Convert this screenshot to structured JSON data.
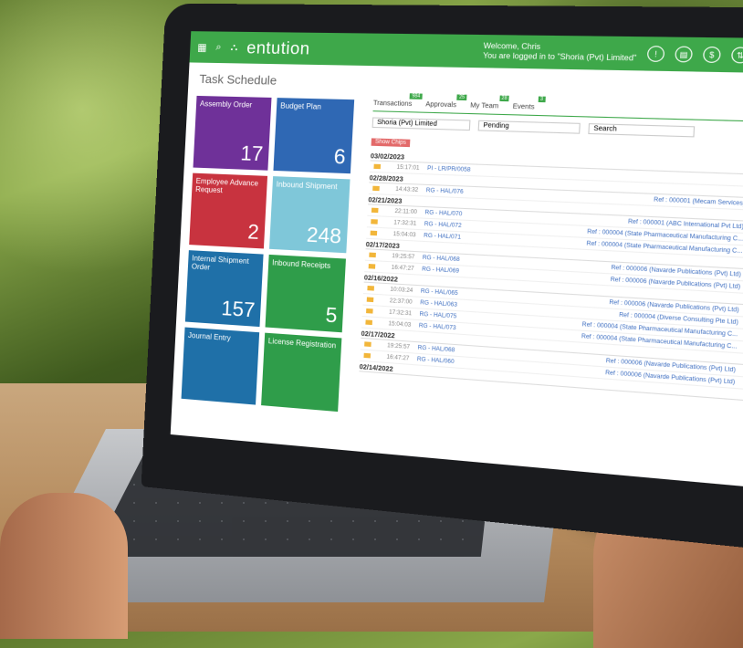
{
  "app": {
    "brand": "entution",
    "welcome": "Welcome, Chris",
    "subtitle": "You are logged in to \"Shoria (Pvt) Limited\""
  },
  "page": {
    "title": "Task Schedule"
  },
  "tiles": [
    {
      "label": "Assembly Order",
      "count": "17",
      "color": "#6f3199"
    },
    {
      "label": "Budget Plan",
      "count": "6",
      "color": "#2f68b4"
    },
    {
      "label": "Employee Advance Request",
      "count": "2",
      "color": "#c8333f"
    },
    {
      "label": "Inbound Shipment",
      "count": "248",
      "color": "#7fc7d9"
    },
    {
      "label": "Internal Shipment Order",
      "count": "157",
      "color": "#1f70a8"
    },
    {
      "label": "Inbound Receipts",
      "count": "5",
      "color": "#2f9d4a"
    },
    {
      "label": "Journal Entry",
      "count": "",
      "color": "#1f70a8"
    },
    {
      "label": "License Registration",
      "count": "",
      "color": "#2f9d4a"
    }
  ],
  "tabs": [
    {
      "label": "Transactions",
      "badge": "984"
    },
    {
      "label": "Approvals",
      "badge": "25"
    },
    {
      "label": "My Team",
      "badge": "28"
    },
    {
      "label": "Events",
      "badge": "3"
    }
  ],
  "filters": {
    "company": "Shoria (Pvt) Limited",
    "status": "Pending",
    "search_placeholder": "Search",
    "chip": "Show Chips"
  },
  "rows": [
    {
      "date": "03/02/2023",
      "entries": [
        {
          "time": "15:17:01",
          "ref": "PI - LR/PR/0058",
          "party": ""
        }
      ]
    },
    {
      "date": "02/28/2023",
      "entries": [
        {
          "time": "14:43:32",
          "ref": "RG - HAL/076",
          "party": "Ref : 000001 (Mecam Services)"
        }
      ]
    },
    {
      "date": "02/21/2023",
      "entries": [
        {
          "time": "22:11:00",
          "ref": "RG - HAL/070",
          "party": "Ref : 000001 (ABC International Pvt Ltd)"
        },
        {
          "time": "17:32:31",
          "ref": "RG - HAL/072",
          "party": "Ref : 000004 (State Pharmaceutical Manufacturing C..."
        },
        {
          "time": "15:04:03",
          "ref": "RG - HAL/071",
          "party": "Ref : 000004 (State Pharmaceutical Manufacturing C..."
        }
      ]
    },
    {
      "date": "02/17/2023",
      "entries": [
        {
          "time": "19:25:57",
          "ref": "RG - HAL/068",
          "party": "Ref : 000006 (Navarde Publications (Pvt) Ltd)"
        },
        {
          "time": "16:47:27",
          "ref": "RG - HAL/069",
          "party": "Ref : 000006 (Navarde Publications (Pvt) Ltd)"
        }
      ]
    },
    {
      "date": "02/16/2022",
      "entries": [
        {
          "time": "10:03:24",
          "ref": "RG - HAL/065",
          "party": "Ref : 000006 (Navarde Publications (Pvt) Ltd)"
        },
        {
          "time": "22:37:00",
          "ref": "RG - HAL/063",
          "party": "Ref : 000004 (Diverse Consulting Pte Ltd)"
        },
        {
          "time": "17:32:31",
          "ref": "RG - HAL/075",
          "party": "Ref : 000004 (State Pharmaceutical Manufacturing C..."
        },
        {
          "time": "15:04:03",
          "ref": "RG - HAL/073",
          "party": "Ref : 000004 (State Pharmaceutical Manufacturing C..."
        }
      ]
    },
    {
      "date": "02/17/2022",
      "entries": [
        {
          "time": "19:25:57",
          "ref": "RG - HAL/068",
          "party": "Ref : 000006 (Navarde Publications (Pvt) Ltd)"
        },
        {
          "time": "16:47:27",
          "ref": "RG - HAL/060",
          "party": "Ref : 000006 (Navarde Publications (Pvt) Ltd)"
        }
      ]
    },
    {
      "date": "02/14/2022",
      "entries": []
    }
  ]
}
